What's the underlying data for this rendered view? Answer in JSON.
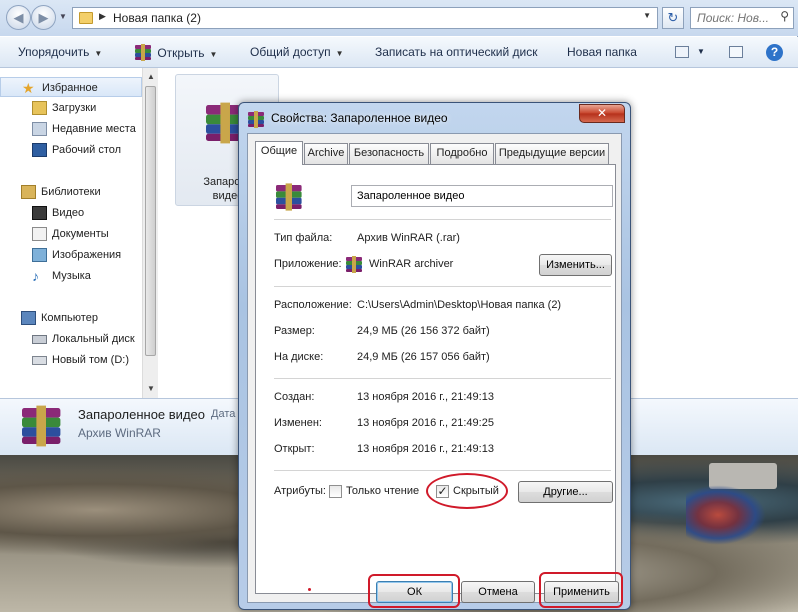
{
  "explorer": {
    "address": {
      "path": "Новая папка (2)",
      "search_placeholder": "Поиск: Нов..."
    },
    "toolbar": {
      "organize": "Упорядочить",
      "open": "Открыть",
      "share": "Общий доступ",
      "burn": "Записать на оптический диск",
      "new_folder": "Новая папка",
      "help": "?"
    },
    "nav": {
      "favorites": "Избранное",
      "downloads": "Загрузки",
      "recent": "Недавние места",
      "desktop": "Рабочий стол",
      "libraries": "Библиотеки",
      "video": "Видео",
      "documents": "Документы",
      "images": "Изображения",
      "music": "Музыка",
      "computer": "Компьютер",
      "local_disk": "Локальный диск",
      "new_volume": "Новый том (D:)"
    },
    "file_tile": {
      "caption_line1": "Запароле",
      "caption_line2": "видео"
    },
    "details": {
      "name": "Запароленное видео",
      "date_label": "Дата",
      "type": "Архив WinRAR"
    }
  },
  "dialog": {
    "title": "Свойства: Запароленное видео",
    "close": "✕",
    "tabs": [
      "Общие",
      "Archive",
      "Безопасность",
      "Подробно",
      "Предыдущие версии"
    ],
    "name_value": "Запароленное видео",
    "file_type_label": "Тип файла:",
    "file_type_value": "Архив WinRAR (.rar)",
    "app_label": "Приложение:",
    "app_value": "WinRAR archiver",
    "change_button": "Изменить...",
    "location_label": "Расположение:",
    "location_value": "C:\\Users\\Admin\\Desktop\\Новая папка (2)",
    "size_label": "Размер:",
    "size_value": "24,9 МБ (26 156 372 байт)",
    "disk_label": "На диске:",
    "disk_value": "24,9 МБ (26 157 056 байт)",
    "created_label": "Создан:",
    "created_value": "13 ноября 2016 г., 21:49:13",
    "modified_label": "Изменен:",
    "modified_value": "13 ноября 2016 г., 21:49:25",
    "opened_label": "Открыт:",
    "opened_value": "13 ноября 2016 г., 21:49:13",
    "attributes_label": "Атрибуты:",
    "readonly_label": "Только чтение",
    "readonly_checked": false,
    "hidden_label": "Скрытый",
    "hidden_checked": true,
    "other_button": "Другие...",
    "ok_button": "ОК",
    "cancel_button": "Отмена",
    "apply_button": "Применить"
  },
  "colors": {
    "highlight_ring": "#d01a2a",
    "title_bar": "#a9c3e2"
  }
}
